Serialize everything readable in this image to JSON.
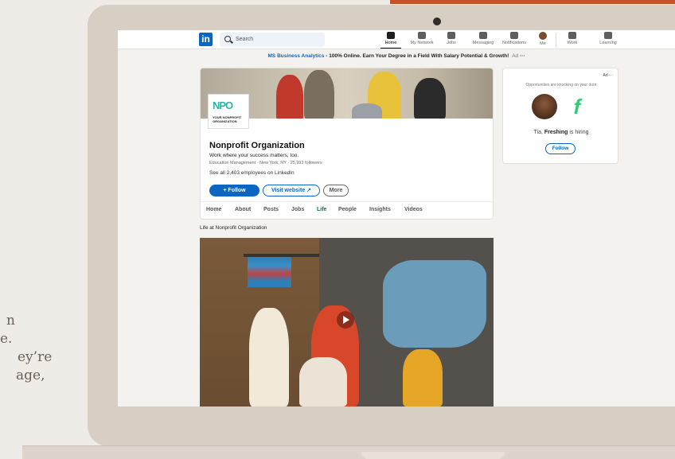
{
  "background_text": {
    "lines": [
      "n",
      "e.",
      "ey’re",
      "age,"
    ]
  },
  "nav": {
    "logo": "in",
    "search_placeholder": "Search",
    "items": [
      {
        "label": "Home",
        "icon": "home-icon",
        "active": true
      },
      {
        "label": "My Network",
        "icon": "network-icon",
        "active": false
      },
      {
        "label": "Jobs",
        "icon": "briefcase-icon",
        "active": false
      },
      {
        "label": "Messaging",
        "icon": "chat-icon",
        "active": false
      },
      {
        "label": "Notifications",
        "icon": "bell-icon",
        "active": false
      },
      {
        "label": "Me",
        "icon": "avatar-icon",
        "active": false
      },
      {
        "label": "Work",
        "icon": "grid-icon",
        "active": false
      },
      {
        "label": "Learning",
        "icon": "play-square-icon",
        "active": false
      }
    ]
  },
  "adline": {
    "link": "MS Business Analytics",
    "text": " - 100% Online. Earn Your Degree in a Field With Salary Potential & Growth!",
    "ad": "Ad",
    "more": "···"
  },
  "company": {
    "logo_mark": "NPO",
    "logo_sub": "YOUR NONPROFIT ORGANIZATION",
    "name": "Nonprofit Organization",
    "tagline": "Work where your success matters, too.",
    "meta": "Education Management · New York, NY · 25,993 followers",
    "employees": "See all 2,403 employees on LinkedIn",
    "follow": "+ Follow",
    "visit": "Visit website ↗",
    "more": "More",
    "tabs": [
      "Home",
      "About",
      "Posts",
      "Jobs",
      "Life",
      "People",
      "Insights",
      "Videos"
    ],
    "active_tab": "Life"
  },
  "ad_card": {
    "label": "Ad ···",
    "headline": "Opportunities are knocking on your door",
    "brand_glyph": "f",
    "hiring_prefix": "Tia, ",
    "hiring_company": "Freshing",
    "hiring_suffix": " is hiring",
    "follow": "Follow"
  },
  "life": {
    "title": "Life at Nonprofit Organization"
  },
  "colors": {
    "linkedin_blue": "#0a66c2",
    "active_tab_green": "#057642",
    "accent": "#c4532b"
  }
}
